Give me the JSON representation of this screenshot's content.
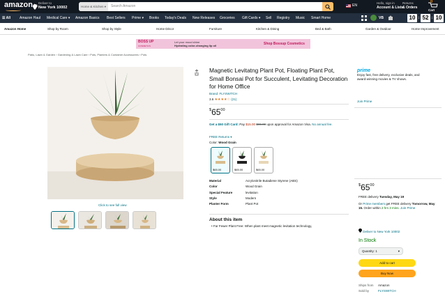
{
  "header": {
    "logo": "amazon",
    "logo_suffix": ".in",
    "deliver_line1": "Deliver to",
    "deliver_line2": "New York 10002",
    "search_category": "Home & Kitchen ▾",
    "search_placeholder": "Search Amazon",
    "language": "EN",
    "account_line1": "Hello, sign in",
    "account_line2": "Account & Lists",
    "returns_line1": "Returns",
    "returns_line2": "& Orders",
    "cart_count": "0",
    "cart_label": "Cart"
  },
  "nav2": {
    "all": "☰ All",
    "items": [
      "Amazon Haul",
      "Medical Care ▾",
      "Amazon Basics",
      "Best Sellers",
      "Prime ▾",
      "Books",
      "Today's Deals",
      "New Releases",
      "Groceries",
      "Gift Cards ▾",
      "Sell",
      "Registry",
      "Music",
      "Smart Home"
    ],
    "user_initials": "VB",
    "clock": [
      "10",
      "52",
      "10"
    ]
  },
  "subnav": {
    "items": [
      "Amazon Home",
      "Shop by Room",
      "Shop by Style",
      "Home Décor",
      "Furniture",
      "Kitchen & Dining",
      "Bed & Bath",
      "Garden & Outdoor",
      "Home Improvement"
    ]
  },
  "ad": {
    "brand": "BOSS UP",
    "brand_sub": "COSMETICS",
    "text_line1": "Let your mood shine",
    "text_line2": "Hydrating color-changing lip oil",
    "cta": "Shop Bossup Cosmetics"
  },
  "breadcrumb": "Patio, Lawn & Garden  ›  Gardening & Lawn Care  ›  Pots, Planters & Container Accessories  ›  Pots",
  "gallery": {
    "zoom_text": "Click to see full view"
  },
  "product": {
    "title": "Magnetic Levitatng Plant Pot, Floating Plant Pot, Small Bonsai Pot for Succulent, Levitating Decoration for Home Office",
    "brand": "Brand: FLYSWITCH",
    "rating_value": "3.6",
    "rating_stars": "★★★★☆",
    "rating_count": "(21)",
    "price_symbol": "$",
    "price_whole": "65",
    "price_fraction": "00",
    "gift_bold": "Get a $50 Gift Card:",
    "gift_text1": " Pay ",
    "gift_pay": "$15.00",
    "gift_strike": "$65.00",
    "gift_text2": " upon approval for Amazon Visa. ",
    "gift_link": "No annual fee.",
    "free_returns": "FREE Returns ▾",
    "color_label": "Color:",
    "color_value": "Wood Grain",
    "swatch_prices": [
      "$65.00",
      "$65.00",
      "$65.00"
    ],
    "specs": [
      {
        "k": "Material",
        "v": "Acrylonitrile Butadiene Styrene (ABS)"
      },
      {
        "k": "Color",
        "v": "Wood Grain"
      },
      {
        "k": "Special Feature",
        "v": "levitation"
      },
      {
        "k": "Style",
        "v": "Modern"
      },
      {
        "k": "Planter Form",
        "v": "Plant Pot"
      }
    ],
    "about_title": "About this item",
    "bullet": "• Far Fewer Plant Free: When plant meet magnetic levitation technology,"
  },
  "buybox": {
    "prime_logo": "prime",
    "prime_text": "Enjoy fast, free delivery, exclusive deals, and award-winning movies & TV shows.",
    "join_prime": "Join Prime",
    "price_symbol": "$",
    "price_whole": "65",
    "price_fraction": "00",
    "delivery1_prefix": "FREE delivery ",
    "delivery1_date": "Tuesday, May 19",
    "delivery2_prefix": "Or ",
    "delivery2_link": "Prime members",
    "delivery2_mid": " get FREE delivery ",
    "delivery2_date": "Tomorrow, May 15.",
    "delivery2_order": " Order within ",
    "delivery2_time": "2 hrs 3 mins.",
    "delivery2_details": " Join Prime",
    "location": "Deliver to New York 10002",
    "stock": "In Stock",
    "quantity": "Quantity: 1",
    "add_to_cart": "Add to cart",
    "buy_now": "Buy Now",
    "ships_from_k": "Ships from",
    "ships_from_v": "Amazon",
    "sold_by_k": "Sold by",
    "sold_by_v": "FLYSWITCH"
  }
}
